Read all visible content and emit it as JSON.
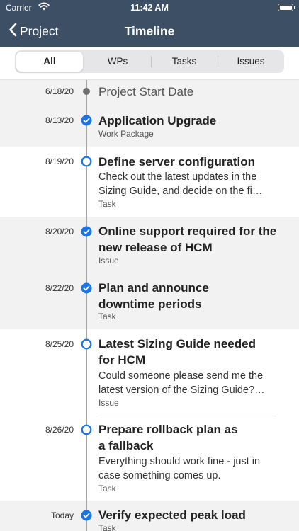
{
  "status": {
    "carrier": "Carrier",
    "time": "11:42 AM"
  },
  "nav": {
    "back_label": "Project",
    "title": "Timeline"
  },
  "filters": [
    "All",
    "WPs",
    "Tasks",
    "Issues"
  ],
  "timeline": [
    {
      "date": "6/18/20",
      "title": "Project Start Date"
    },
    {
      "date": "8/13/20",
      "title": "Application Upgrade",
      "type": "Work Package"
    },
    {
      "date": "8/19/20",
      "title": "Define server configuration",
      "body": [
        "Check out the latest updates in the",
        "Sizing Guide, and decide on the fi…"
      ],
      "type": "Task"
    },
    {
      "date": "8/20/20",
      "title": [
        "Online support required for the",
        "new release of HCM"
      ],
      "type": "Issue"
    },
    {
      "date": "8/22/20",
      "title": [
        "Plan and announce",
        "downtime periods"
      ],
      "type": "Task"
    },
    {
      "date": "8/25/20",
      "title": [
        "Latest Sizing Guide needed",
        "for HCM"
      ],
      "body": [
        "Could someone please send me the",
        "latest version of the Sizing Guide?…"
      ],
      "type": "Issue"
    },
    {
      "date": "8/26/20",
      "title": [
        "Prepare rollback plan as",
        "a fallback"
      ],
      "body": [
        "Everything should work fine - just in",
        "case something comes up."
      ],
      "type": "Task"
    },
    {
      "date": "Today",
      "title": "Verify expected peak load",
      "type": "Task"
    }
  ],
  "colors": {
    "header": "#3d4f64",
    "accent": "#1a73e8",
    "rail": "#a5a5a5"
  }
}
